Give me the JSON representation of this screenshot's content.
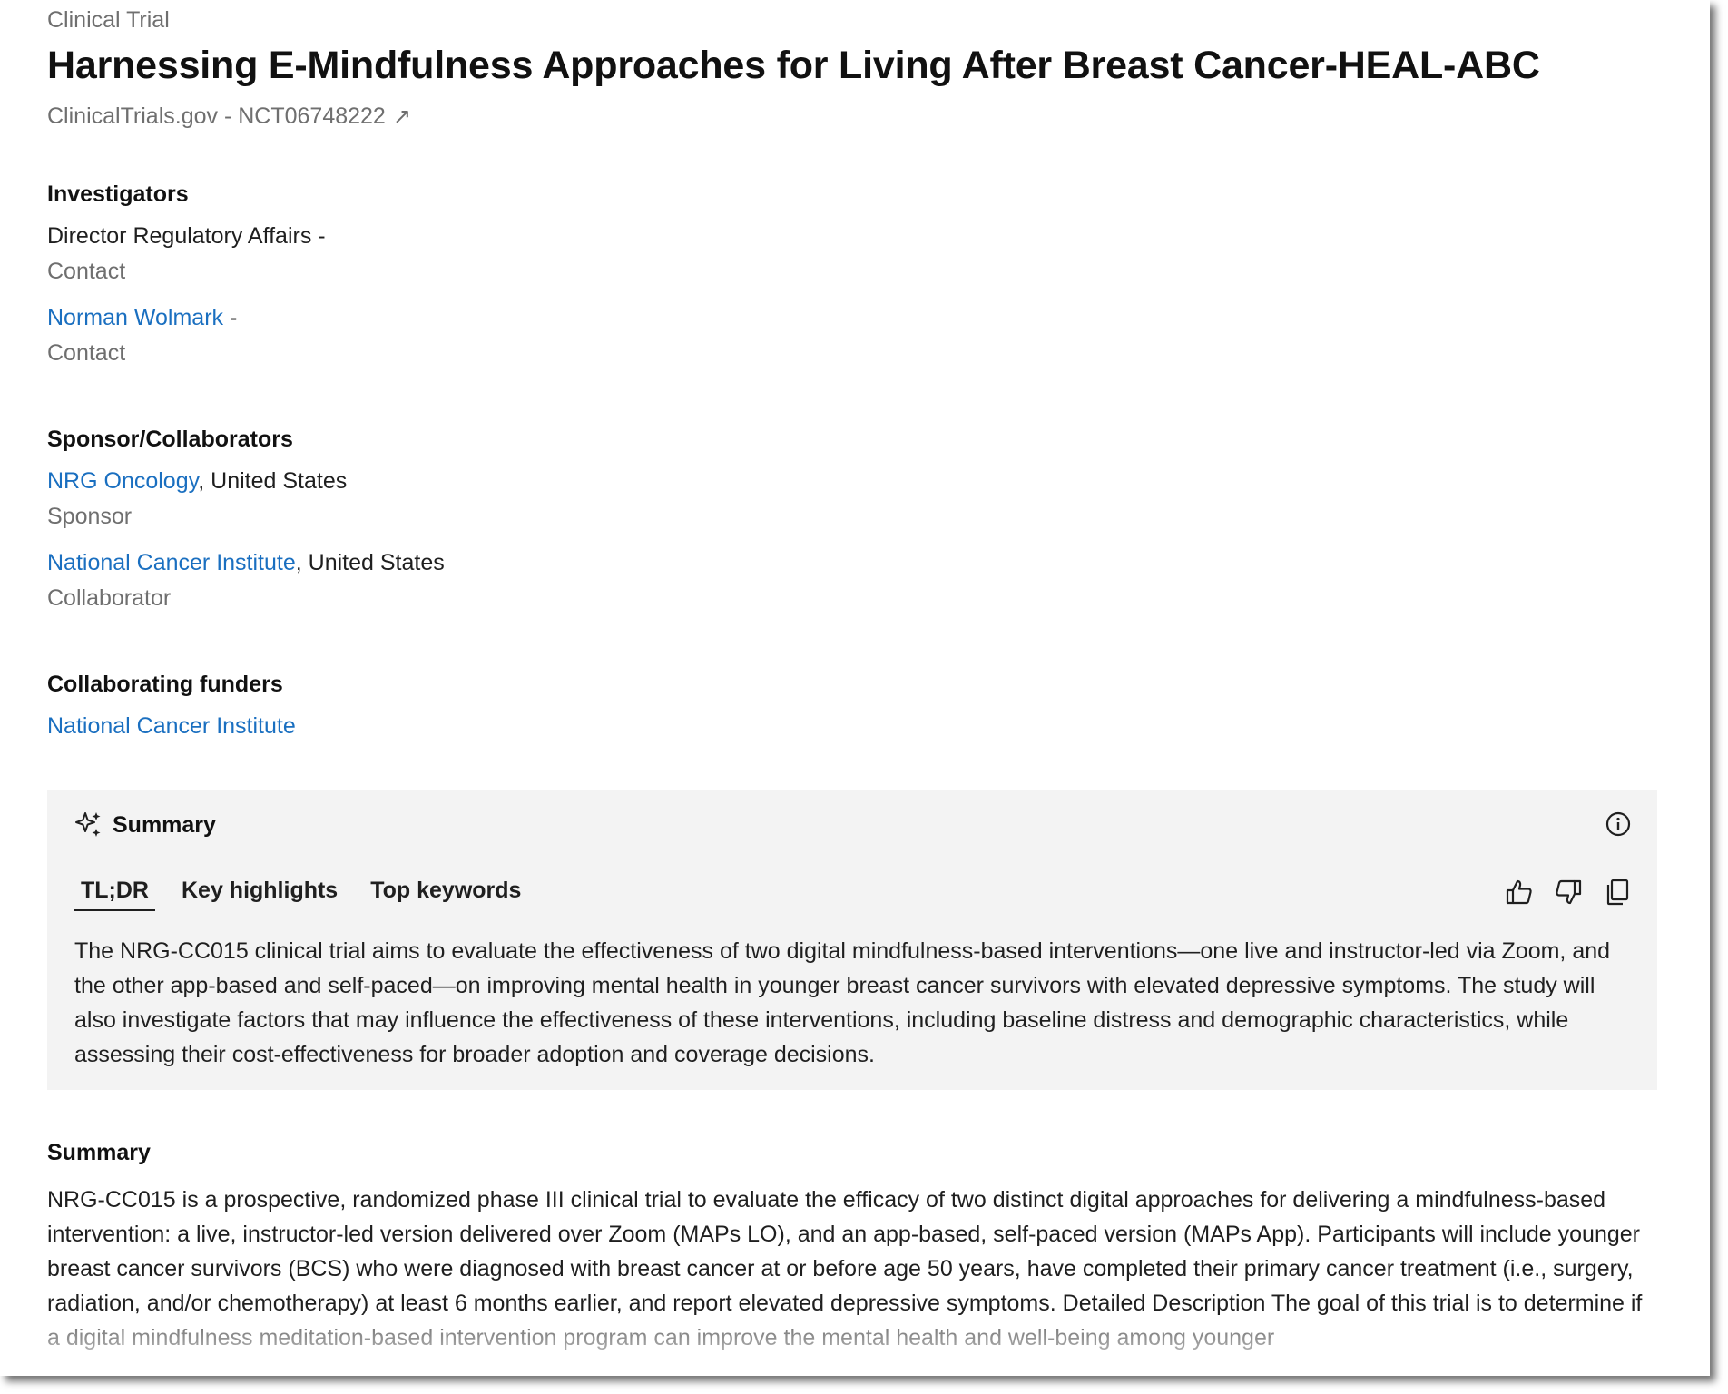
{
  "header": {
    "kicker": "Clinical Trial",
    "title": "Harnessing E-Mindfulness Approaches for Living After Breast Cancer-HEAL-ABC",
    "source": "ClinicalTrials.gov - NCT06748222",
    "source_icon": "external-link-arrow"
  },
  "investigators": {
    "heading": "Investigators",
    "items": [
      {
        "name": "Director Regulatory Affairs",
        "sep": " -",
        "role": "Contact"
      },
      {
        "name": "Norman Wolmark",
        "sep": " -",
        "role": "Contact"
      }
    ]
  },
  "sponsors": {
    "heading": "Sponsor/Collaborators",
    "items": [
      {
        "name": "NRG Oncology",
        "location": ", United States",
        "role": "Sponsor"
      },
      {
        "name": "National Cancer Institute",
        "location": ", United States",
        "role": "Collaborator"
      }
    ]
  },
  "funders": {
    "heading": "Collaborating funders",
    "items": [
      {
        "name": "National Cancer Institute"
      }
    ]
  },
  "ai_summary": {
    "title": "Summary",
    "title_icon": "sparkle-icon",
    "tabs": [
      {
        "label": "TL;DR",
        "active": true
      },
      {
        "label": "Key highlights",
        "active": false
      },
      {
        "label": "Top keywords",
        "active": false
      }
    ],
    "action_icons": [
      "thumbs-up-icon",
      "thumbs-down-icon",
      "copy-icon",
      "info-icon"
    ],
    "body": "The NRG-CC015 clinical trial aims to evaluate the effectiveness of two digital mindfulness-based interventions—one live and instructor-led via Zoom, and the other app-based and self-paced—on improving mental health in younger breast cancer survivors with elevated depressive symptoms. The study will also investigate factors that may influence the effectiveness of these interventions, including baseline distress and demographic characteristics, while assessing their cost-effectiveness for broader adoption and coverage decisions."
  },
  "summary": {
    "heading": "Summary",
    "text": "NRG-CC015 is a prospective, randomized phase III clinical trial to evaluate the efficacy of two distinct digital approaches for delivering a mindfulness-based intervention: a live, instructor-led version delivered over Zoom (MAPs LO), and an app-based, self-paced version (MAPs App). Participants will include younger breast cancer survivors (BCS) who were diagnosed with breast cancer at or before age 50 years, have completed their primary cancer treatment (i.e., surgery, radiation, and/or chemotherapy) at least 6 months earlier, and report elevated depressive symptoms. Detailed Description The goal of this trial is to determine if a digital mindfulness meditation-based intervention program can improve the mental health and well-being among younger"
  },
  "colors": {
    "link": "#1a6fc0",
    "muted": "#6f6f6f",
    "panel_bg": "#f3f3f3"
  }
}
